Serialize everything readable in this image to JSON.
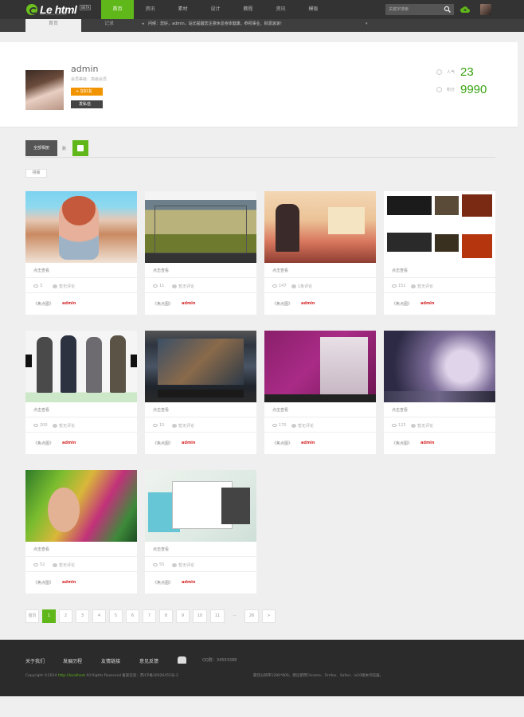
{
  "header": {
    "logo_text": "Le html",
    "logo_badge": "BETA",
    "logo_sub": "best website template",
    "nav": [
      "首页",
      "资讯",
      "素材",
      "设计",
      "教程",
      "资讯",
      "模板"
    ],
    "search_placeholder": "关键字搜索",
    "accent_color": "#5fb719"
  },
  "subnav": {
    "tabs": [
      "首页",
      "记录"
    ],
    "notice": "问候：您好，admin，站长提醒您注意休息身体健康，恭祝事业、财源滚滚！"
  },
  "profile": {
    "username": "admin",
    "level": "会员等级：高级会员",
    "follow_label": "+ 加好友",
    "message_label": "发私信",
    "popularity_label": "人气",
    "popularity_value": "23",
    "score_label": "积分",
    "score_value": "9990"
  },
  "filter": {
    "all_label": "全部相册",
    "label": "默",
    "tag": "排版"
  },
  "cards": [
    {
      "title": "点击查看",
      "views": "3",
      "comments": "暂无评论",
      "category": "《焦点图》",
      "author": "admin"
    },
    {
      "title": "点击查看",
      "views": "11",
      "comments": "暂无评论",
      "category": "《焦点图》",
      "author": "admin"
    },
    {
      "title": "点击查看",
      "views": "147",
      "comments": "1条评论",
      "category": "《焦点图》",
      "author": "admin"
    },
    {
      "title": "点击查看",
      "views": "151",
      "comments": "暂无评论",
      "category": "《焦点图》",
      "author": "admin"
    },
    {
      "title": "点击查看",
      "views": "200",
      "comments": "暂无评论",
      "category": "《焦点图》",
      "author": "admin"
    },
    {
      "title": "点击查看",
      "views": "15",
      "comments": "暂无评论",
      "category": "《焦点图》",
      "author": "admin"
    },
    {
      "title": "点击查看",
      "views": "170",
      "comments": "暂无评论",
      "category": "《焦点图》",
      "author": "admin"
    },
    {
      "title": "点击查看",
      "views": "123",
      "comments": "暂无评论",
      "category": "《焦点图》",
      "author": "admin"
    },
    {
      "title": "点击查看",
      "views": "52",
      "comments": "暂无评论",
      "category": "《焦点图》",
      "author": "admin"
    },
    {
      "title": "点击查看",
      "views": "55",
      "comments": "暂无评论",
      "category": "《焦点图》",
      "author": "admin"
    }
  ],
  "pagination": {
    "first": "首页",
    "pages": [
      "1",
      "2",
      "3",
      "4",
      "5",
      "6",
      "7",
      "8",
      "9",
      "10",
      "11"
    ],
    "current": "1",
    "ellipsis": "...",
    "last": "26",
    "next": ">"
  },
  "footer": {
    "links": [
      "关于我们",
      "发展历程",
      "友情链接",
      "意见反馈"
    ],
    "qq": "QQ群：34593388",
    "copyright_prefix": "Copyright ©2014",
    "copyright_link": "http://localhost",
    "copyright_suffix": "All Rights Reserved   备案信息：苏ICP备10026455号-2",
    "compat": "最佳分辨率1280*800，建议使用Chrome、Firefox、Safari、ie10版本浏览器。"
  }
}
